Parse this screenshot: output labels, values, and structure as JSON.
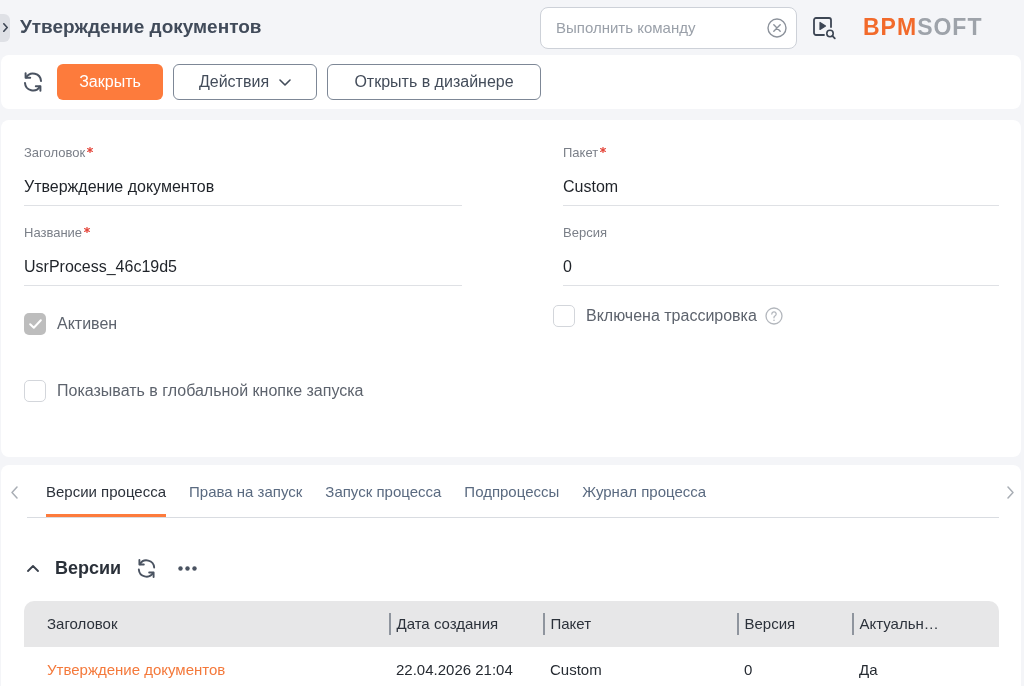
{
  "header": {
    "title": "Утверждение документов",
    "command_field": {
      "placeholder": "Выполнить команду"
    },
    "logo": {
      "accent": "BPM",
      "rest": "SOFT"
    }
  },
  "toolbar": {
    "buttons": [
      {
        "label": "Закрыть",
        "kind": "primary"
      },
      {
        "label": "Действия",
        "kind": "dropdown"
      },
      {
        "label": "Открыть в дизайнере",
        "kind": "outline"
      }
    ]
  },
  "form": {
    "columns": [
      [
        {
          "kind": "field",
          "label": "Заголовок",
          "required": true,
          "value": "Утверждение документов"
        },
        {
          "kind": "field",
          "label": "Название",
          "required": true,
          "value": "UsrProcess_46c19d5"
        },
        {
          "kind": "checkbox",
          "label": "Активен",
          "checked": true,
          "disabled": true,
          "help": false
        },
        {
          "kind": "checkbox",
          "label": "Показывать в глобальной кнопке запуска",
          "checked": false,
          "disabled": false,
          "help": false
        }
      ],
      [
        {
          "kind": "field",
          "label": "Пакет",
          "required": true,
          "value": "Custom"
        },
        {
          "kind": "field",
          "label": "Версия",
          "required": false,
          "value": "0"
        },
        {
          "kind": "checkbox",
          "label": "Включена трассировка",
          "checked": false,
          "disabled": false,
          "help": true
        }
      ]
    ]
  },
  "tabs": [
    {
      "label": "Версии процесса",
      "selected": true
    },
    {
      "label": "Права на запуск",
      "selected": false
    },
    {
      "label": "Запуск процесса",
      "selected": false
    },
    {
      "label": "Подпроцессы",
      "selected": false
    },
    {
      "label": "Журнал процесса",
      "selected": false
    }
  ],
  "versions": {
    "title": "Версии",
    "expanded": true,
    "table": {
      "columns": [
        {
          "label": "Заголовок",
          "kind": "link"
        },
        {
          "label": "Дата создания",
          "kind": "text"
        },
        {
          "label": "Пакет",
          "kind": "text"
        },
        {
          "label": "Версия",
          "kind": "text"
        },
        {
          "label": "Актуальн…",
          "kind": "text"
        }
      ],
      "rows": [
        {
          "cells": [
            "Утверждение документов",
            "22.04.2026 21:04",
            "Custom",
            "0",
            "Да"
          ]
        }
      ]
    }
  }
}
